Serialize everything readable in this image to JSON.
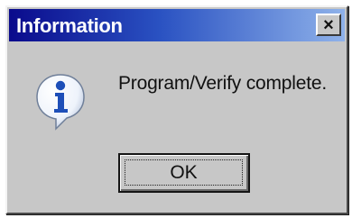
{
  "dialog": {
    "title": "Information",
    "close_label": "×",
    "icon": "info-icon",
    "message": "Program/Verify complete.",
    "ok_label": "OK"
  },
  "colors": {
    "titlebar_start": "#0a0a8c",
    "titlebar_end": "#8fb2ea",
    "face": "#c7c7c7",
    "icon_blue": "#1e4fb8"
  }
}
